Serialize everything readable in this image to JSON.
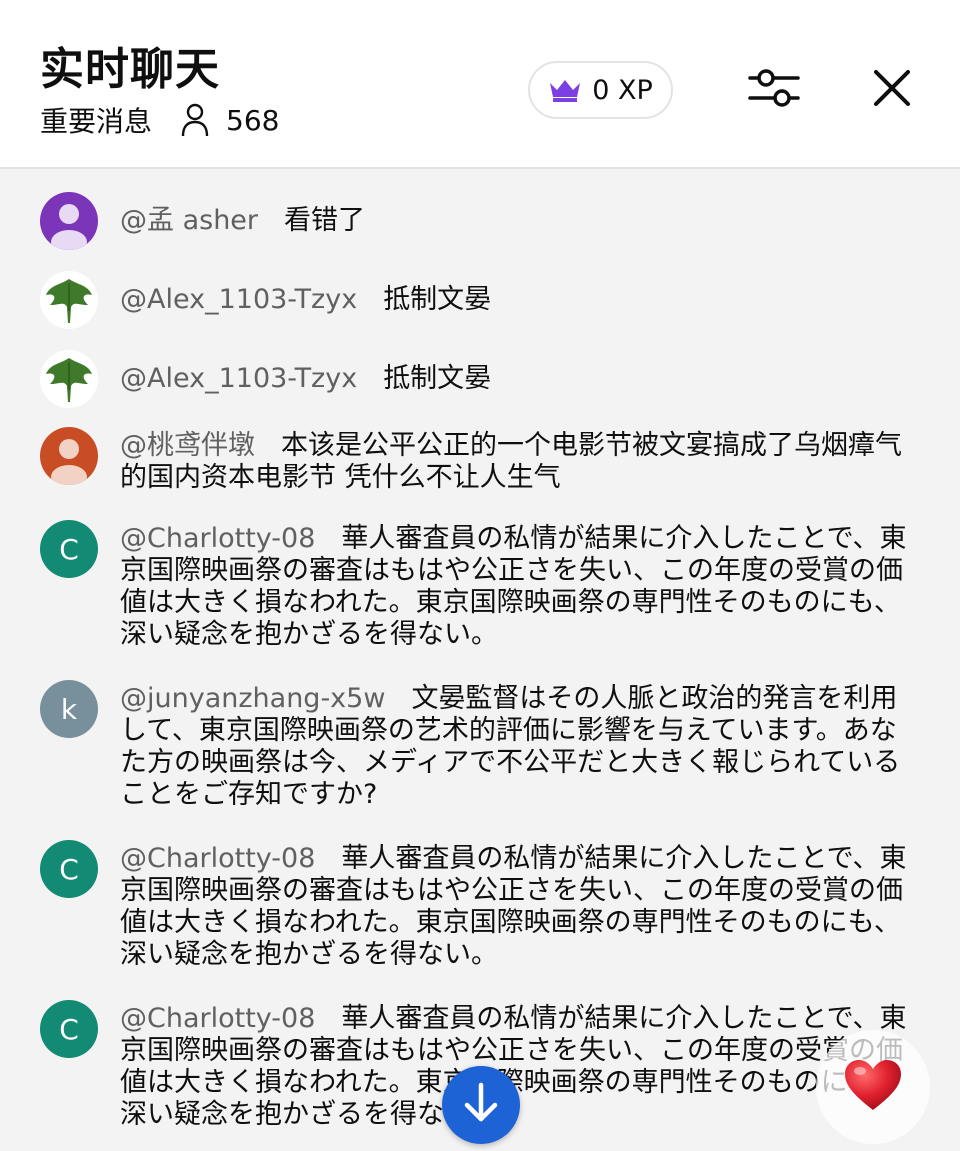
{
  "header": {
    "title": "实时聊天",
    "mode": "重要消息",
    "viewers": "568",
    "xp": "0 XP",
    "icons": {
      "viewers": "person-icon",
      "crown": "crown-icon",
      "filter": "sliders-icon",
      "close": "close-icon"
    },
    "crown_color": "#7b3fe4"
  },
  "messages": [
    {
      "author": "@孟 asher",
      "text": "看错了",
      "avatar": "purple-person-avatar"
    },
    {
      "author": "@Alex_1103-Tzyx",
      "text": "抵制文晏",
      "avatar": "leaf-avatar"
    },
    {
      "author": "@Alex_1103-Tzyx",
      "text": "抵制文晏",
      "avatar": "leaf-avatar"
    },
    {
      "author": "@桃鸢伴墩",
      "text": "本该是公平公正的一个电影节被文宴搞成了乌烟瘴气的国内资本电影节 凭什么不让人生气",
      "avatar": "orange-person-avatar"
    },
    {
      "author": "@Charlotty-08",
      "text": "華人審査員の私情が結果に介入したことで、東京国際映画祭の審査はもはや公正さを失い、この年度の受賞の価値は大きく損なわれた。東京国際映画祭の専門性そのものにも、深い疑念を抱かざるを得ない。",
      "avatar_letter": "C"
    },
    {
      "author": "@junyanzhang-x5w",
      "text": "文晏監督はその人脈と政治的発言を利用して、東京国際映画祭の艺术的評価に影響を与えています。あなた方の映画祭は今、メディアで不公平だと大きく報じられていることをご存知ですか?",
      "avatar_letter": "k"
    },
    {
      "author": "@Charlotty-08",
      "text": "華人審査員の私情が結果に介入したことで、東京国際映画祭の審査はもはや公正さを失い、この年度の受賞の価値は大きく損なわれた。東京国際映画祭の専門性そのものにも、深い疑念を抱かざるを得ない。",
      "avatar_letter": "C"
    },
    {
      "author": "@Charlotty-08",
      "text": "華人審査員の私情が結果に介入したことで、東京国際映画祭の審査はもはや公正さを失い、この年度の受賞の価値は大きく損なわれた。東京国際映画祭の専門性そのものにも、深い疑念を抱かざるを得ない。",
      "avatar_letter": "C"
    }
  ],
  "floating": {
    "scroll_down_icon": "arrow-down-icon",
    "heart_icon": "heart-icon",
    "heart_color": "#e0202e",
    "scroll_color": "#1d63d6"
  }
}
